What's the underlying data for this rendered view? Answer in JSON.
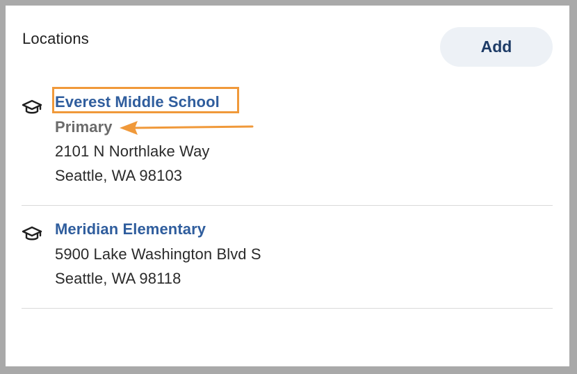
{
  "card": {
    "title": "Locations",
    "add_label": "Add"
  },
  "locations": [
    {
      "name": "Everest Middle School",
      "tag": "Primary",
      "address_line1": "2101 N Northlake Way",
      "address_line2": "Seattle, WA 98103",
      "icon": "graduation-cap-icon"
    },
    {
      "name": "Meridian Elementary",
      "address_line1": "5900 Lake Washington Blvd S",
      "address_line2": "Seattle, WA 98118",
      "icon": "graduation-cap-icon"
    }
  ],
  "colors": {
    "link": "#2f5d9d",
    "button_bg": "#edf1f6",
    "annotation": "#f0993a"
  }
}
